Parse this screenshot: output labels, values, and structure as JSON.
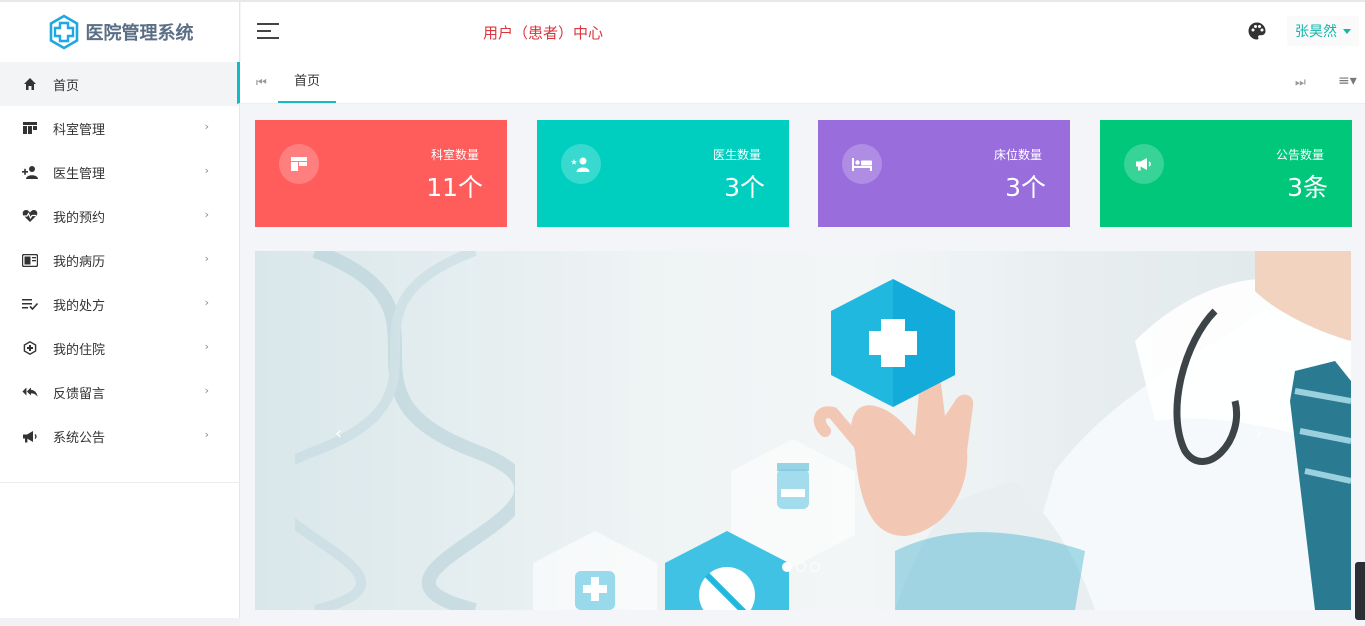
{
  "app": {
    "title": "医院管理系统",
    "center_title": "用户（患者）中心",
    "username": "张昊然"
  },
  "sidebar": {
    "items": [
      {
        "label": "首页",
        "icon": "home-icon"
      },
      {
        "label": "科室管理",
        "icon": "department-icon"
      },
      {
        "label": "医生管理",
        "icon": "add-user-icon"
      },
      {
        "label": "我的预约",
        "icon": "heartbeat-icon"
      },
      {
        "label": "我的病历",
        "icon": "record-icon"
      },
      {
        "label": "我的处方",
        "icon": "checklist-icon"
      },
      {
        "label": "我的住院",
        "icon": "hospital-icon"
      },
      {
        "label": "反馈留言",
        "icon": "reply-all-icon"
      },
      {
        "label": "系统公告",
        "icon": "megaphone-icon"
      }
    ]
  },
  "tabs": {
    "home_label": "首页"
  },
  "stats": [
    {
      "label": "科室数量",
      "value": "11个",
      "color": "#ff5c5c",
      "icon": "department-icon"
    },
    {
      "label": "医生数量",
      "value": "3个",
      "color": "#00cfc0",
      "icon": "doctor-icon"
    },
    {
      "label": "床位数量",
      "value": "3个",
      "color": "#9a6ddd",
      "icon": "bed-icon"
    },
    {
      "label": "公告数量",
      "value": "3条",
      "color": "#00c77a",
      "icon": "megaphone-icon"
    }
  ],
  "carousel": {
    "prev_glyph": "‹",
    "next_glyph": "›",
    "slides": 3,
    "active_slide": 1
  },
  "colors": {
    "accent": "#12bcc6",
    "title_red": "#d9363e",
    "user_teal": "#13b5a8"
  }
}
